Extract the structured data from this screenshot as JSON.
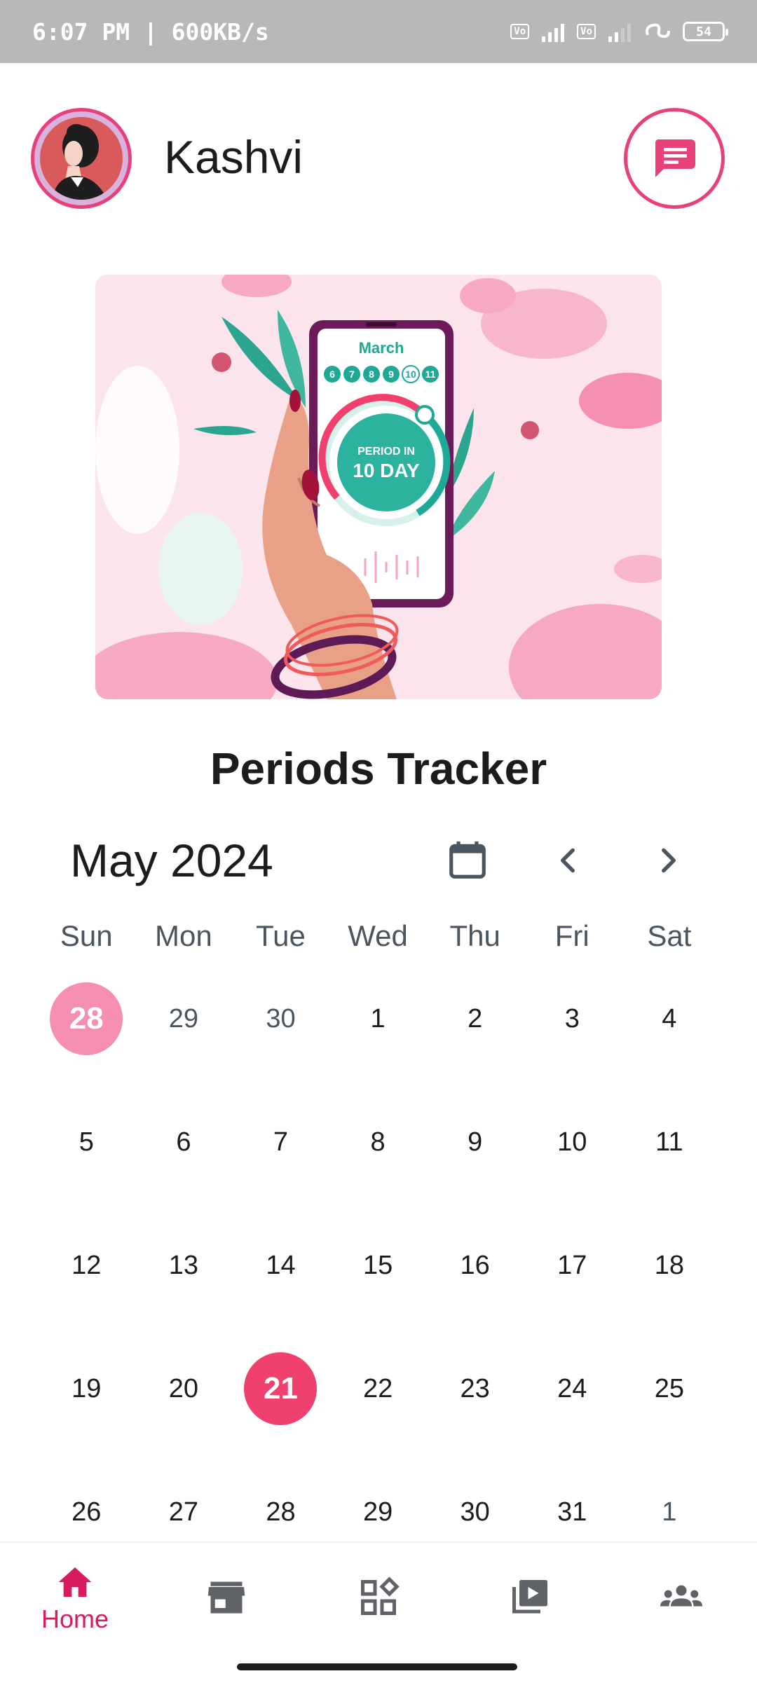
{
  "status_bar": {
    "time_speed": "6:07 PM | 600KB/s",
    "battery": "54"
  },
  "header": {
    "name": "Kashvi"
  },
  "banner": {
    "month": "March",
    "dates": [
      "6",
      "7",
      "8",
      "9",
      "10",
      "11"
    ],
    "period_line1": "PERIOD IN",
    "period_line2": "10 DAY"
  },
  "page_title": "Periods Tracker",
  "calendar": {
    "month_label": "May 2024",
    "weekdays": [
      "Sun",
      "Mon",
      "Tue",
      "Wed",
      "Thu",
      "Fri",
      "Sat"
    ],
    "weeks": [
      [
        "28",
        "29",
        "30",
        "1",
        "2",
        "3",
        "4"
      ],
      [
        "5",
        "6",
        "7",
        "8",
        "9",
        "10",
        "11"
      ],
      [
        "12",
        "13",
        "14",
        "15",
        "16",
        "17",
        "18"
      ],
      [
        "19",
        "20",
        "21",
        "22",
        "23",
        "24",
        "25"
      ],
      [
        "26",
        "27",
        "28",
        "29",
        "30",
        "31",
        "1"
      ]
    ]
  },
  "bottom_nav": {
    "home_label": "Home"
  },
  "colors": {
    "accent": "#e8407a",
    "period_day": "#f58fb0",
    "today": "#f0406e",
    "nav_active": "#d81b60"
  }
}
